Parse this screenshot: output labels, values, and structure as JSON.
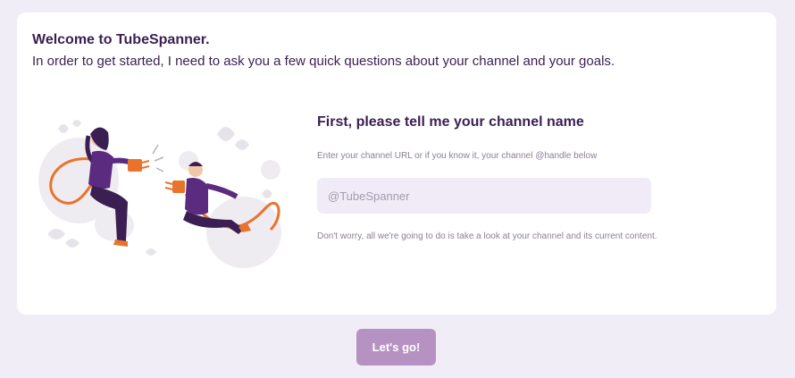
{
  "welcome": {
    "title": "Welcome to TubeSpanner.",
    "subtitle": "In order to get started, I need to ask you a few quick questions about your channel and your goals."
  },
  "form": {
    "title": "First, please tell me your channel name",
    "hint": "Enter your channel URL or if you know it, your channel @handle below",
    "input_placeholder": "@TubeSpanner",
    "input_value": "",
    "note": "Don't worry, all we're going to do is take a look at your channel and its current content."
  },
  "actions": {
    "go_label": "Let's go!"
  },
  "illustration": {
    "icon": "people-plug-connection-illustration"
  },
  "colors": {
    "background": "#f0edf6",
    "text": "#3b1f52",
    "accent": "#b692c3",
    "input_bg": "#f0ebf6",
    "orange": "#e8742c",
    "purple": "#5a2b7e"
  }
}
